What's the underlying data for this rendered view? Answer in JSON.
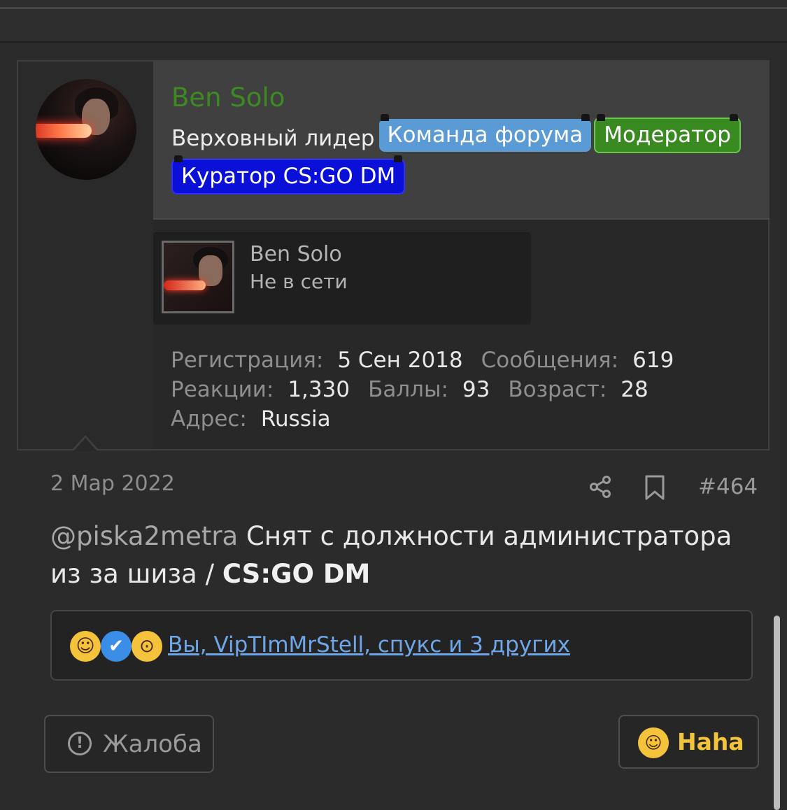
{
  "author": {
    "username": "Ben Solo",
    "user_title": "Верховный лидер",
    "badges": [
      "Команда форума",
      "Модератор",
      "Куратор CS:GO DM"
    ],
    "mini_card": {
      "name": "Ben Solo",
      "status": "Не в сети"
    },
    "stats": [
      {
        "label": "Регистрация:",
        "value": "5 Сен 2018"
      },
      {
        "label": "Сообщения:",
        "value": "619"
      },
      {
        "label": "Реакции:",
        "value": "1,330"
      },
      {
        "label": "Баллы:",
        "value": "93"
      },
      {
        "label": "Возраст:",
        "value": "28"
      },
      {
        "label": "Адрес:",
        "value": "Russia"
      }
    ]
  },
  "post": {
    "date": "2 Мар 2022",
    "number": "#464",
    "mention": "@piska2metra",
    "text": "Снят с должности администратора из за шиза /",
    "text_bold": "CS:GO DM"
  },
  "reactions": {
    "icons": [
      "laugh-icon",
      "like-icon",
      "wow-icon"
    ],
    "summary": "Вы, VipTImMrStell, спукс и 3 других"
  },
  "actions": {
    "report_label": "Жалоба",
    "haha_label": "Haha"
  },
  "colors": {
    "username": "#3e8a22",
    "badge_team": "#5b9bd5",
    "badge_mod": "#3a8a22",
    "badge_curator": "#0a10d8",
    "link": "#6fa6e8",
    "haha": "#f2c43a"
  }
}
